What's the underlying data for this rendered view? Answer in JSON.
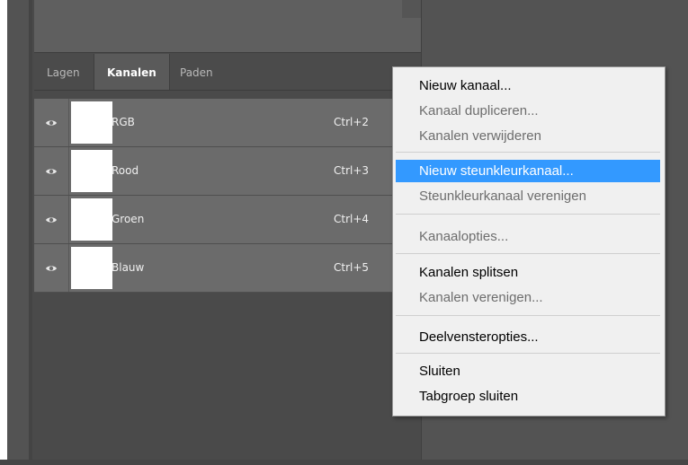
{
  "panel": {
    "tabs": [
      {
        "label": "Lagen"
      },
      {
        "label": "Kanalen"
      },
      {
        "label": "Paden"
      }
    ],
    "channels": [
      {
        "name": "RGB",
        "shortcut": "Ctrl+2"
      },
      {
        "name": "Rood",
        "shortcut": "Ctrl+3"
      },
      {
        "name": "Groen",
        "shortcut": "Ctrl+4"
      },
      {
        "name": "Blauw",
        "shortcut": "Ctrl+5"
      }
    ]
  },
  "menu": {
    "items": [
      {
        "label": "Nieuw kanaal...",
        "enabled": true
      },
      {
        "label": "Kanaal dupliceren...",
        "enabled": false
      },
      {
        "label": "Kanalen verwijderen",
        "enabled": false
      },
      {
        "label": "Nieuw steunkleurkanaal...",
        "enabled": true,
        "highlighted": true
      },
      {
        "label": "Steunkleurkanaal verenigen",
        "enabled": false
      },
      {
        "label": "Kanaalopties...",
        "enabled": false
      },
      {
        "label": "Kanalen splitsen",
        "enabled": true
      },
      {
        "label": "Kanalen verenigen...",
        "enabled": false
      },
      {
        "label": "Deelvensteropties...",
        "enabled": true
      },
      {
        "label": "Sluiten",
        "enabled": true
      },
      {
        "label": "Tabgroep sluiten",
        "enabled": true
      }
    ]
  },
  "colors": {
    "highlight": "#3399ff",
    "panel_bg": "#535353",
    "row_bg": "#6b6b6b"
  },
  "icons": {
    "visibility": "eye-icon"
  }
}
